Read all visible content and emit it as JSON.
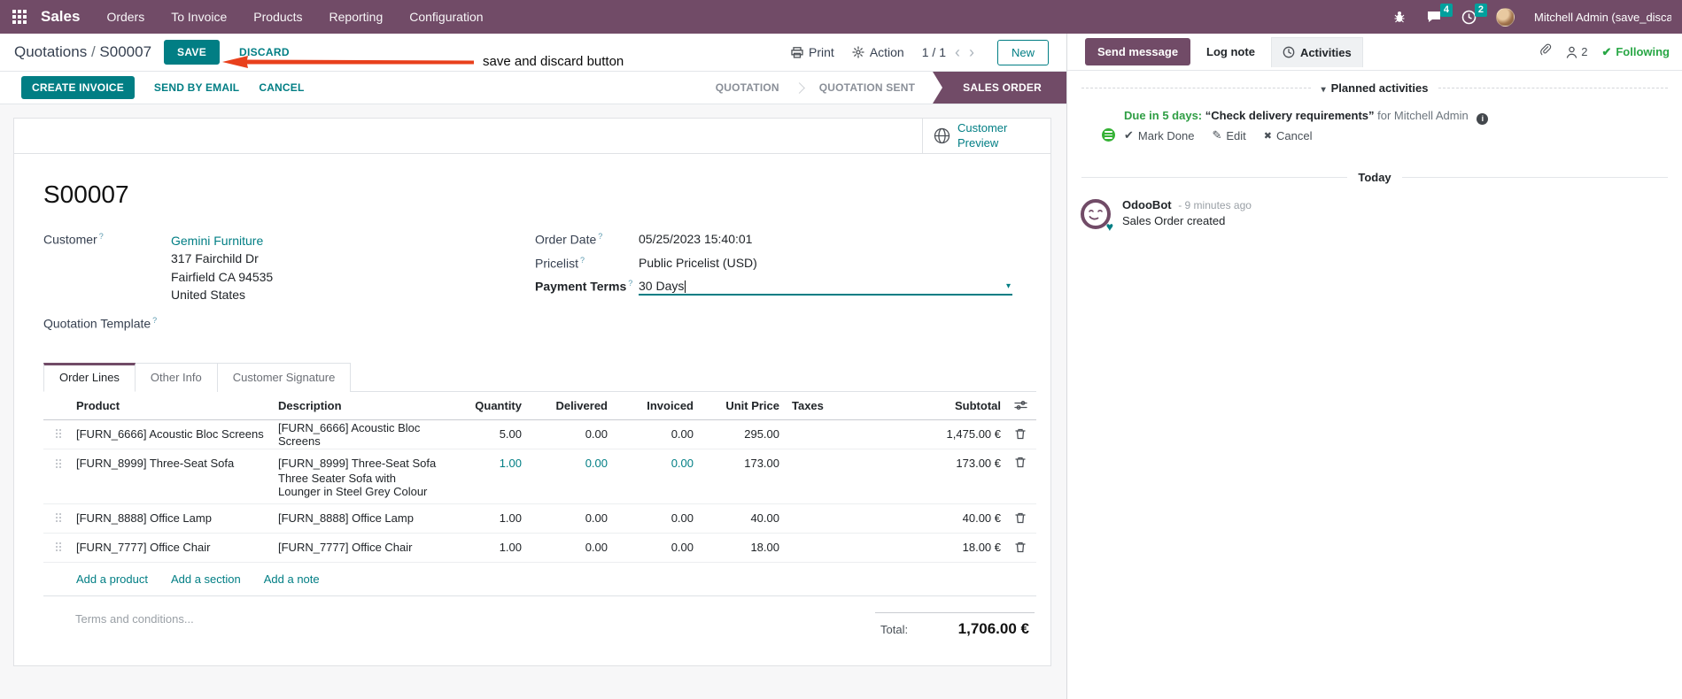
{
  "colors": {
    "brand_purple": "#714B67",
    "accent_teal": "#017e84",
    "badge_teal": "#00A09D",
    "success_green": "#28a745",
    "annotation_red": "#e8401c"
  },
  "icons": {
    "apps": "grid-icon",
    "bug": "bug-icon",
    "messages": "chat-bubble-icon",
    "activities_clock": "clock-icon",
    "print": "printer-icon",
    "action": "gear-icon",
    "preview": "globe-icon",
    "optional_columns": "sliders-icon",
    "delete_row": "trash-icon",
    "attach": "paperclip-icon",
    "followers": "person-icon",
    "check": "✔",
    "edit": "✎",
    "cancel": "✖",
    "caret": "▾",
    "pager_prev": "‹",
    "pager_next": "›"
  },
  "nav": {
    "app_name": "Sales",
    "menus": [
      "Orders",
      "To Invoice",
      "Products",
      "Reporting",
      "Configuration"
    ],
    "systray": {
      "messages_badge": "4",
      "activities_badge": "2",
      "user": "Mitchell Admin (save_discar"
    }
  },
  "control_panel": {
    "breadcrumb_parent": "Quotations",
    "breadcrumb_current": "S00007",
    "save_label": "SAVE",
    "discard_label": "DISCARD",
    "annotation": "save and discard button",
    "print_label": "Print",
    "action_label": "Action",
    "pager": "1 / 1",
    "new_label": "New"
  },
  "statusbar": {
    "create_invoice": "CREATE INVOICE",
    "send_by_email": "SEND BY EMAIL",
    "cancel": "CANCEL",
    "states": [
      "QUOTATION",
      "QUOTATION SENT",
      "SALES ORDER"
    ],
    "active_state": "SALES ORDER"
  },
  "sheet": {
    "customer_preview": "Customer Preview",
    "name": "S00007",
    "fields": {
      "customer_label": "Customer",
      "customer_name": "Gemini Furniture",
      "address": [
        "317 Fairchild Dr",
        "Fairfield CA 94535",
        "United States"
      ],
      "quotation_template_label": "Quotation Template",
      "order_date_label": "Order Date",
      "order_date": "05/25/2023 15:40:01",
      "pricelist_label": "Pricelist",
      "pricelist": "Public Pricelist (USD)",
      "payment_terms_label": "Payment Terms",
      "payment_terms": "30 Days"
    },
    "tabs": [
      "Order Lines",
      "Other Info",
      "Customer Signature"
    ],
    "order_lines": {
      "columns": [
        "Product",
        "Description",
        "Quantity",
        "Delivered",
        "Invoiced",
        "Unit Price",
        "Taxes",
        "Subtotal"
      ],
      "rows": [
        {
          "product": "[FURN_6666] Acoustic Bloc Screens",
          "description": "[FURN_6666] Acoustic Bloc Screens",
          "description2": "",
          "quantity": "5.00",
          "delivered": "0.00",
          "invoiced": "0.00",
          "unit_price": "295.00",
          "taxes": "",
          "subtotal": "1,475.00 €"
        },
        {
          "product": "[FURN_8999] Three-Seat Sofa",
          "description": "[FURN_8999] Three-Seat Sofa",
          "description2": "Three Seater Sofa with Lounger in Steel Grey Colour",
          "quantity": "1.00",
          "delivered": "0.00",
          "invoiced": "0.00",
          "unit_price": "173.00",
          "taxes": "",
          "subtotal": "173.00 €"
        },
        {
          "product": "[FURN_8888] Office Lamp",
          "description": "[FURN_8888] Office Lamp",
          "description2": "",
          "quantity": "1.00",
          "delivered": "0.00",
          "invoiced": "0.00",
          "unit_price": "40.00",
          "taxes": "",
          "subtotal": "40.00 €"
        },
        {
          "product": "[FURN_7777] Office Chair",
          "description": "[FURN_7777] Office Chair",
          "description2": "",
          "quantity": "1.00",
          "delivered": "0.00",
          "invoiced": "0.00",
          "unit_price": "18.00",
          "taxes": "",
          "subtotal": "18.00 €"
        }
      ],
      "footer_links": [
        "Add a product",
        "Add a section",
        "Add a note"
      ]
    },
    "terms_placeholder": "Terms and conditions...",
    "total_label": "Total:",
    "total_value": "1,706.00 €"
  },
  "chatter": {
    "send_message": "Send message",
    "log_note": "Log note",
    "activities": "Activities",
    "followers_count": "2",
    "following": "Following",
    "planned_title": "Planned activities",
    "activity": {
      "due": "Due in 5 days:",
      "title": "“Check delivery requirements”",
      "assignee": "for Mitchell Admin",
      "mark_done": "Mark Done",
      "edit": "Edit",
      "cancel": "Cancel"
    },
    "today": "Today",
    "message": {
      "author": "OdooBot",
      "time": "- 9 minutes ago",
      "body": "Sales Order created"
    }
  }
}
